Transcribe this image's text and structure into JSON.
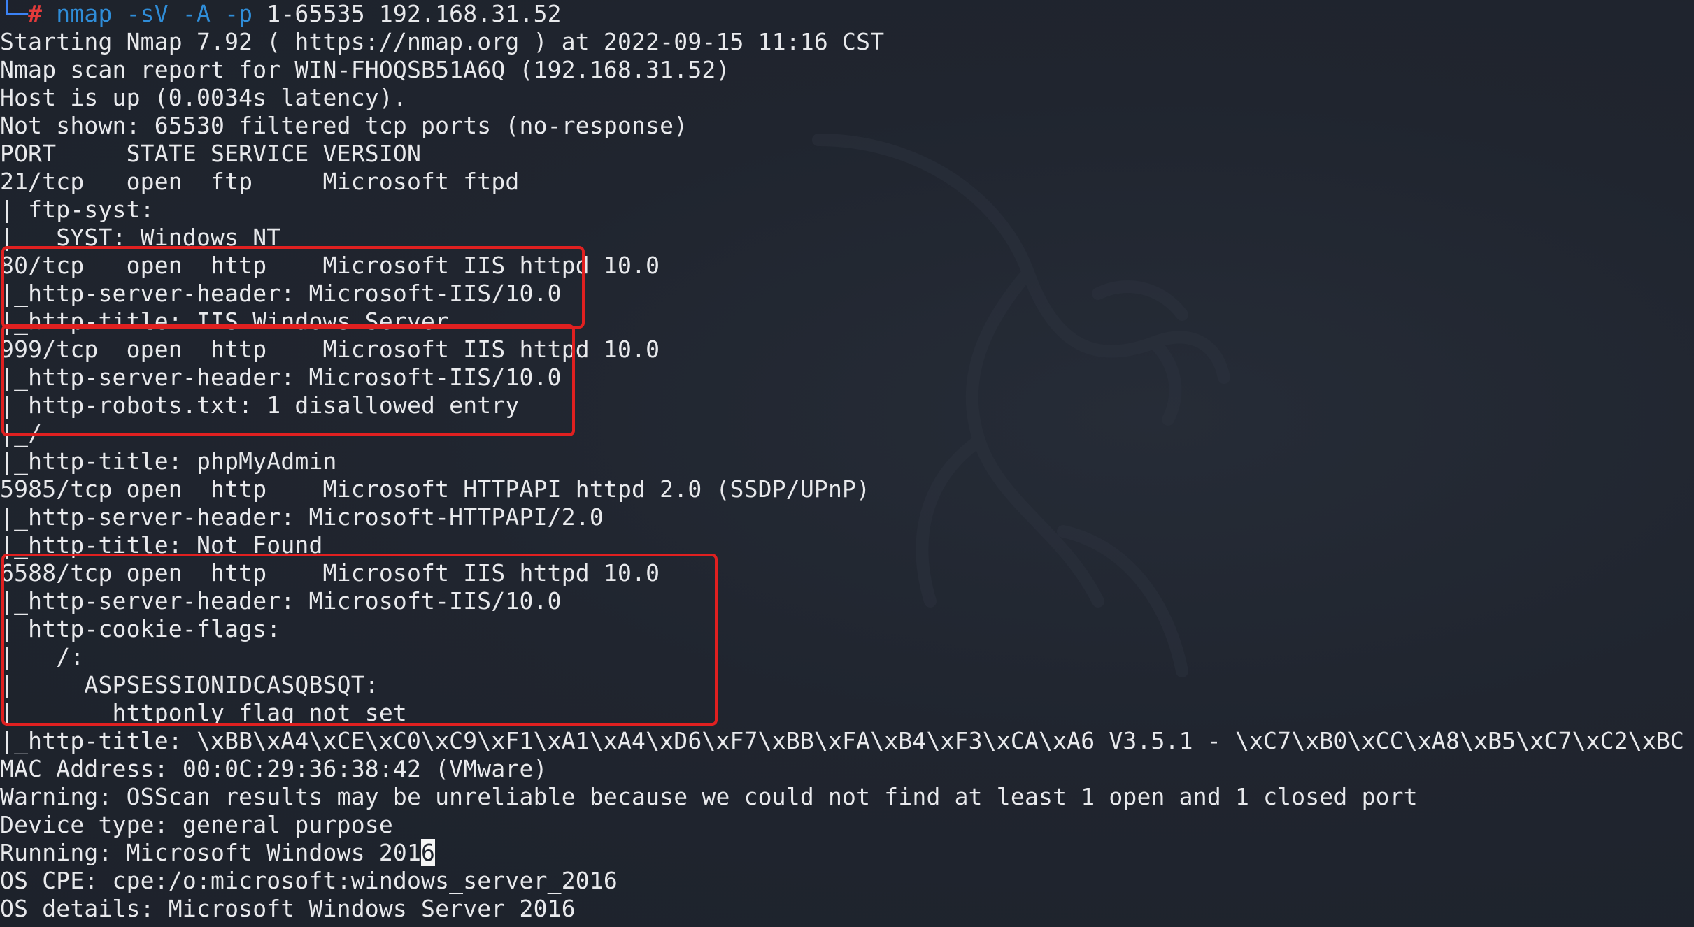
{
  "terminal": {
    "prompt": {
      "corner": "└─",
      "hash": "# ",
      "command": "nmap -sV -A -p",
      "args": " 1-65535 192.168.31.52"
    },
    "lines": [
      "Starting Nmap 7.92 ( https://nmap.org ) at 2022-09-15 11:16 CST",
      "Nmap scan report for WIN-FHOQSB51A6Q (192.168.31.52)",
      "Host is up (0.0034s latency).",
      "Not shown: 65530 filtered tcp ports (no-response)",
      "PORT     STATE SERVICE VERSION",
      "21/tcp   open  ftp     Microsoft ftpd",
      "| ftp-syst:",
      "|   SYST: Windows NT",
      "80/tcp   open  http    Microsoft IIS httpd 10.0",
      "|_http-server-header: Microsoft-IIS/10.0",
      "|_http-title: IIS Windows Server",
      "999/tcp  open  http    Microsoft IIS httpd 10.0",
      "|_http-server-header: Microsoft-IIS/10.0",
      "| http-robots.txt: 1 disallowed entry",
      "|_/",
      "|_http-title: phpMyAdmin",
      "5985/tcp open  http    Microsoft HTTPAPI httpd 2.0 (SSDP/UPnP)",
      "|_http-server-header: Microsoft-HTTPAPI/2.0",
      "|_http-title: Not Found",
      "6588/tcp open  http    Microsoft IIS httpd 10.0",
      "|_http-server-header: Microsoft-IIS/10.0",
      "| http-cookie-flags:",
      "|   /:",
      "|     ASPSESSIONIDCASQBSQT:",
      "|_      httponly flag not set",
      "|_http-title: \\xBB\\xA4\\xCE\\xC0\\xC9\\xF1\\xA1\\xA4\\xD6\\xF7\\xBB\\xFA\\xB4\\xF3\\xCA\\xA6 V3.5.1 - \\xC7\\xB0\\xCC\\xA8\\xB5\\xC7\\xC2\\xBC",
      "MAC Address: 00:0C:29:36:38:42 (VMware)",
      "Warning: OSScan results may be unreliable because we could not find at least 1 open and 1 closed port",
      "Device type: general purpose",
      {
        "before": "Running: Microsoft Windows 201",
        "cursor": "6",
        "after": ""
      },
      "OS CPE: cpe:/o:microsoft:windows_server_2016",
      "OS details: Microsoft Windows Server 2016"
    ]
  },
  "colors": {
    "background": "#1f242e",
    "text": "#e8e9ec",
    "prompt_corner": "#3b82f6",
    "prompt_hash": "#e23b3b",
    "command": "#2f8dd8",
    "highlight_box": "#e02020"
  },
  "icons": {
    "watermark": "kali-dragon-icon"
  }
}
